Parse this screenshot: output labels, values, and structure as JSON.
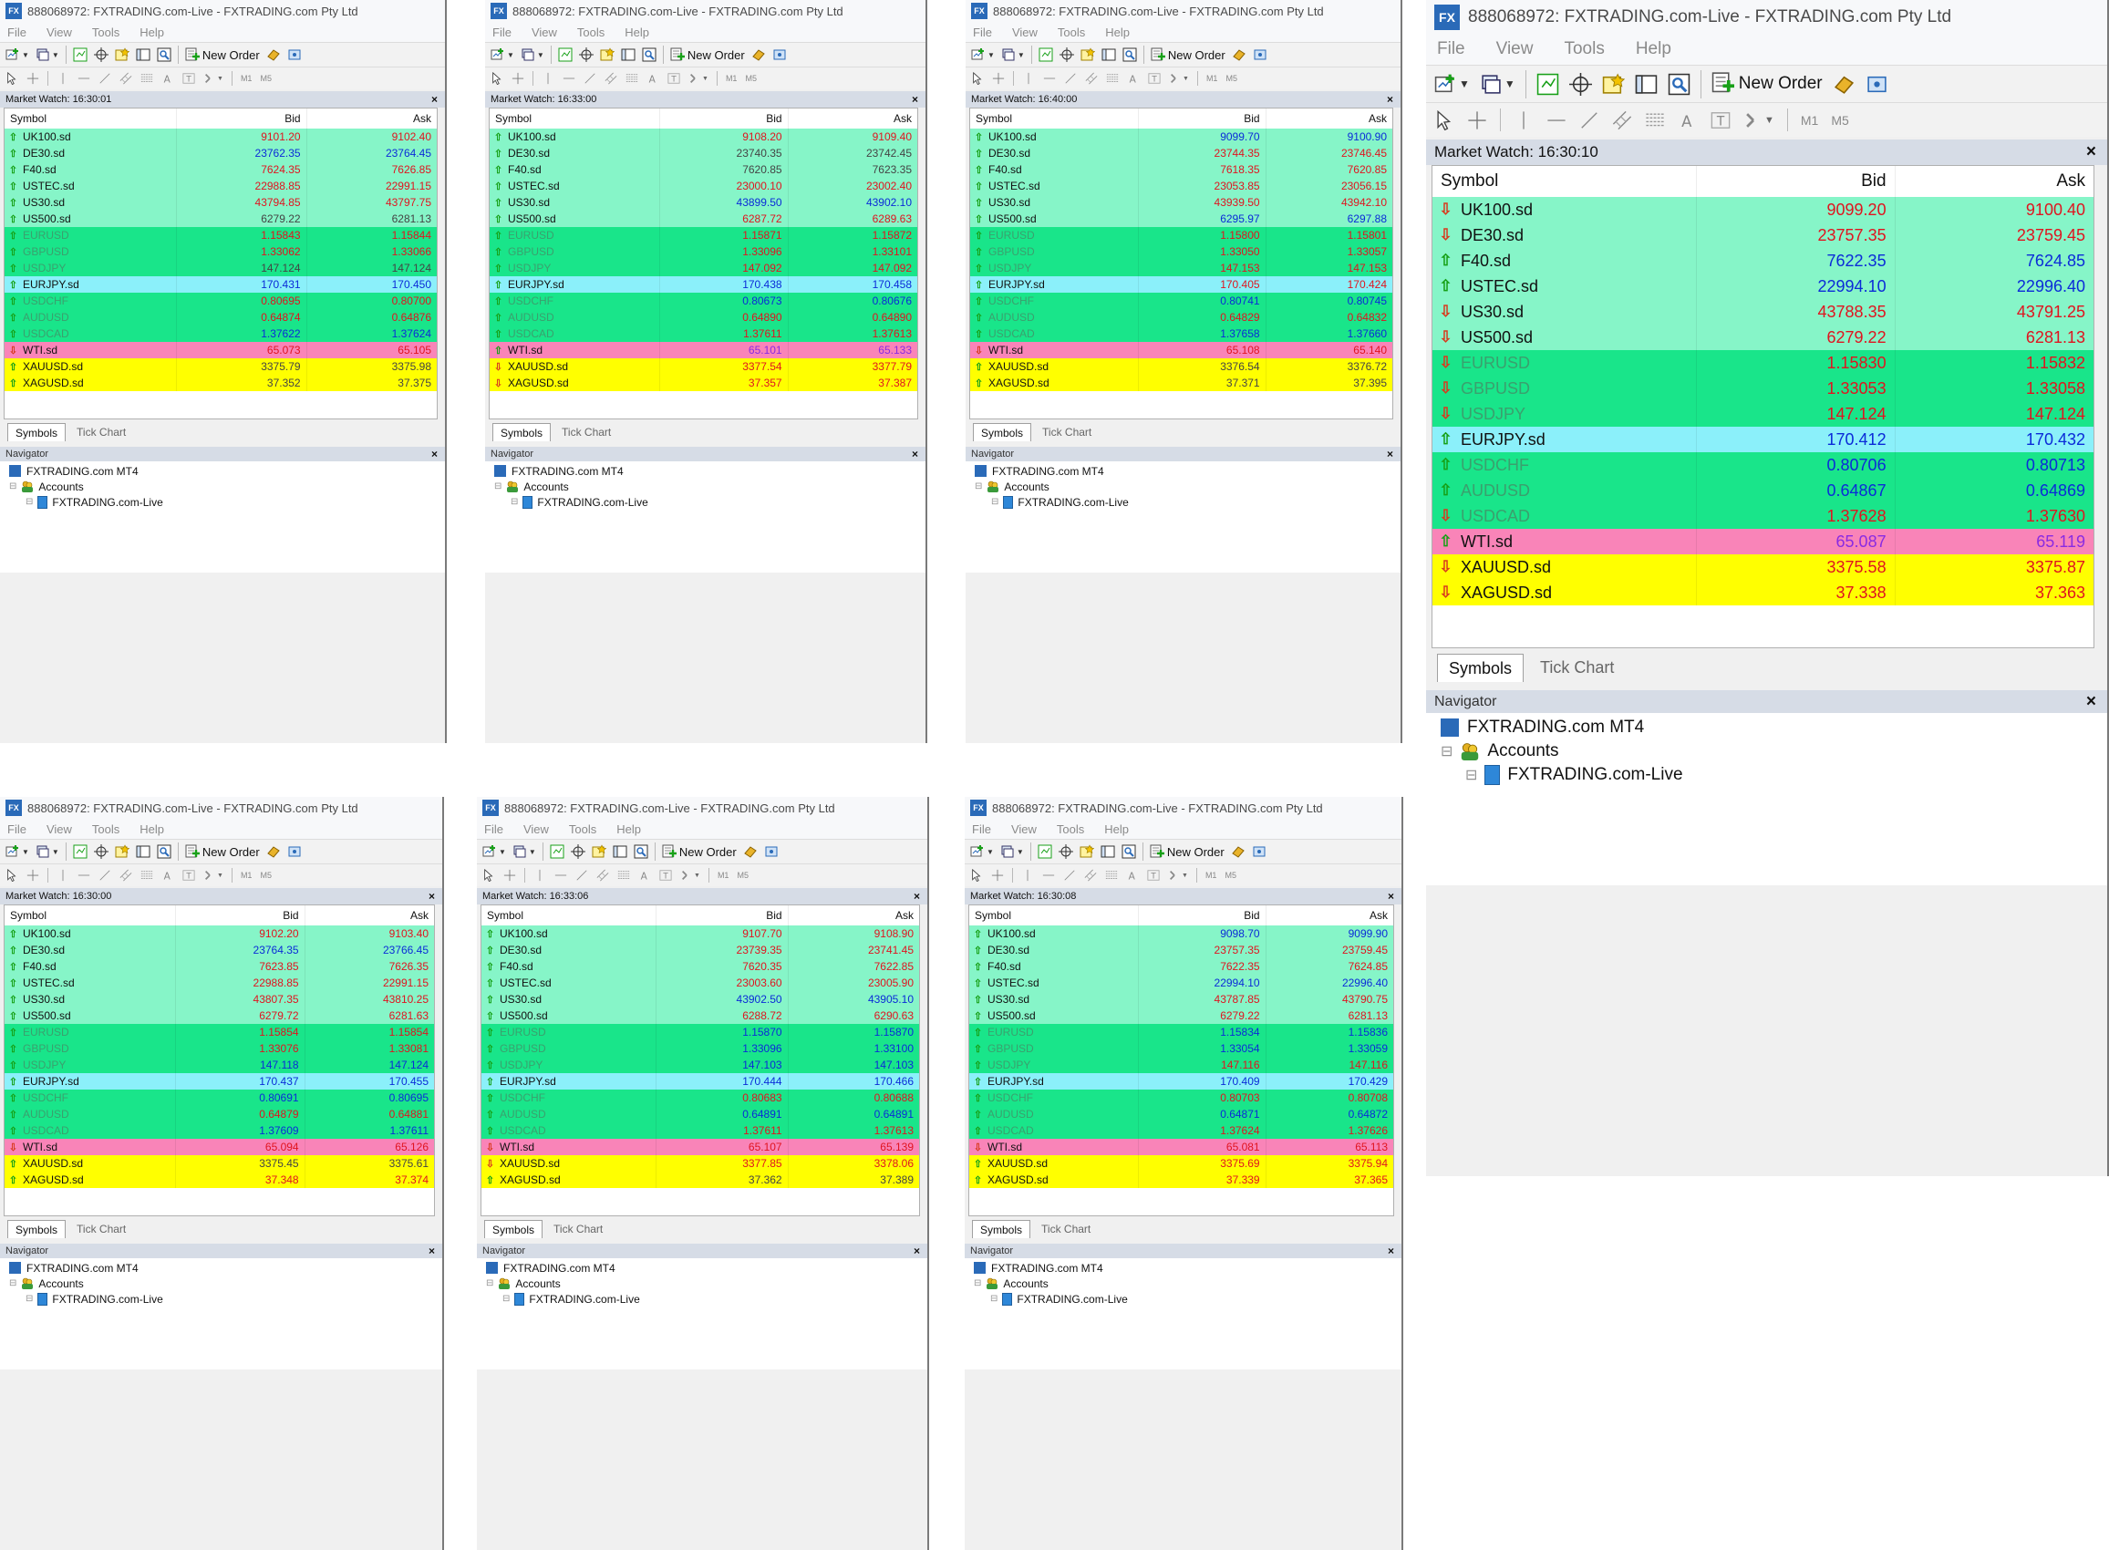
{
  "window": {
    "title": "888068972: FXTRADING.com-Live - FXTRADING.com Pty Ltd",
    "app_icon": "FX",
    "menu": [
      "File",
      "View",
      "Tools",
      "Help"
    ],
    "new_order_label": "New Order",
    "timeframe_labels": [
      "M1",
      "M5"
    ]
  },
  "market_watch": {
    "title_prefix": "Market Watch: ",
    "columns": [
      "Symbol",
      "Bid",
      "Ask"
    ],
    "tabs": [
      "Symbols",
      "Tick Chart"
    ]
  },
  "navigator": {
    "title": "Navigator",
    "root": "FXTRADING.com MT4",
    "accounts": "Accounts",
    "account": "FXTRADING.com-Live"
  },
  "colors": {
    "index_row": "#86f5c8",
    "fx_row": "#19e58a",
    "eurjpy_row": "#8bf0fa",
    "wti_row": "#f984b8",
    "metal_row": "#ffff00",
    "fx_symbol_text": "#3aa06e",
    "tick_up": "#16a016",
    "tick_down": "#d83a1e",
    "price_up": "#0b2bd8",
    "price_down": "#e0141f",
    "price_neutral": "#444444",
    "price_violet": "#8a2be2"
  },
  "snapshots": [
    {
      "time": "16:30:01",
      "rows": [
        {
          "symbol": "UK100.sd",
          "bid": "9101.20",
          "ask": "9102.40",
          "tick": "up",
          "color": "down"
        },
        {
          "symbol": "DE30.sd",
          "bid": "23762.35",
          "ask": "23764.45",
          "tick": "up",
          "color": "up"
        },
        {
          "symbol": "F40.sd",
          "bid": "7624.35",
          "ask": "7626.85",
          "tick": "up",
          "color": "down"
        },
        {
          "symbol": "USTEC.sd",
          "bid": "22988.85",
          "ask": "22991.15",
          "tick": "up",
          "color": "down"
        },
        {
          "symbol": "US30.sd",
          "bid": "43794.85",
          "ask": "43797.75",
          "tick": "up",
          "color": "down"
        },
        {
          "symbol": "US500.sd",
          "bid": "6279.22",
          "ask": "6281.13",
          "tick": "up",
          "color": "neutral"
        },
        {
          "symbol": "EURUSD",
          "bid": "1.15843",
          "ask": "1.15844",
          "tick": "up",
          "color": "down"
        },
        {
          "symbol": "GBPUSD",
          "bid": "1.33062",
          "ask": "1.33066",
          "tick": "up",
          "color": "down"
        },
        {
          "symbol": "USDJPY",
          "bid": "147.124",
          "ask": "147.124",
          "tick": "up",
          "color": "neutral"
        },
        {
          "symbol": "EURJPY.sd",
          "bid": "170.431",
          "ask": "170.450",
          "tick": "up",
          "color": "up"
        },
        {
          "symbol": "USDCHF",
          "bid": "0.80695",
          "ask": "0.80700",
          "tick": "up",
          "color": "down"
        },
        {
          "symbol": "AUDUSD",
          "bid": "0.64874",
          "ask": "0.64876",
          "tick": "up",
          "color": "down"
        },
        {
          "symbol": "USDCAD",
          "bid": "1.37622",
          "ask": "1.37624",
          "tick": "up",
          "color": "up"
        },
        {
          "symbol": "WTI.sd",
          "bid": "65.073",
          "ask": "65.105",
          "tick": "down",
          "color": "down"
        },
        {
          "symbol": "XAUUSD.sd",
          "bid": "3375.79",
          "ask": "3375.98",
          "tick": "up",
          "color": "neutral"
        },
        {
          "symbol": "XAGUSD.sd",
          "bid": "37.352",
          "ask": "37.375",
          "tick": "up",
          "color": "neutral"
        }
      ]
    },
    {
      "time": "16:33:00",
      "rows": [
        {
          "symbol": "UK100.sd",
          "bid": "9108.20",
          "ask": "9109.40",
          "tick": "up",
          "color": "down"
        },
        {
          "symbol": "DE30.sd",
          "bid": "23740.35",
          "ask": "23742.45",
          "tick": "up",
          "color": "neutral"
        },
        {
          "symbol": "F40.sd",
          "bid": "7620.85",
          "ask": "7623.35",
          "tick": "up",
          "color": "neutral"
        },
        {
          "symbol": "USTEC.sd",
          "bid": "23000.10",
          "ask": "23002.40",
          "tick": "up",
          "color": "down"
        },
        {
          "symbol": "US30.sd",
          "bid": "43899.50",
          "ask": "43902.10",
          "tick": "up",
          "color": "up"
        },
        {
          "symbol": "US500.sd",
          "bid": "6287.72",
          "ask": "6289.63",
          "tick": "up",
          "color": "down"
        },
        {
          "symbol": "EURUSD",
          "bid": "1.15871",
          "ask": "1.15872",
          "tick": "up",
          "color": "down"
        },
        {
          "symbol": "GBPUSD",
          "bid": "1.33096",
          "ask": "1.33101",
          "tick": "up",
          "color": "down"
        },
        {
          "symbol": "USDJPY",
          "bid": "147.092",
          "ask": "147.092",
          "tick": "up",
          "color": "down"
        },
        {
          "symbol": "EURJPY.sd",
          "bid": "170.438",
          "ask": "170.458",
          "tick": "up",
          "color": "up"
        },
        {
          "symbol": "USDCHF",
          "bid": "0.80673",
          "ask": "0.80676",
          "tick": "up",
          "color": "up"
        },
        {
          "symbol": "AUDUSD",
          "bid": "0.64890",
          "ask": "0.64890",
          "tick": "up",
          "color": "down"
        },
        {
          "symbol": "USDCAD",
          "bid": "1.37611",
          "ask": "1.37613",
          "tick": "up",
          "color": "down"
        },
        {
          "symbol": "WTI.sd",
          "bid": "65.101",
          "ask": "65.133",
          "tick": "up",
          "color": "violet"
        },
        {
          "symbol": "XAUUSD.sd",
          "bid": "3377.54",
          "ask": "3377.79",
          "tick": "down",
          "color": "down"
        },
        {
          "symbol": "XAGUSD.sd",
          "bid": "37.357",
          "ask": "37.387",
          "tick": "down",
          "color": "down"
        }
      ]
    },
    {
      "time": "16:40:00",
      "rows": [
        {
          "symbol": "UK100.sd",
          "bid": "9099.70",
          "ask": "9100.90",
          "tick": "up",
          "color": "up"
        },
        {
          "symbol": "DE30.sd",
          "bid": "23744.35",
          "ask": "23746.45",
          "tick": "up",
          "color": "down"
        },
        {
          "symbol": "F40.sd",
          "bid": "7618.35",
          "ask": "7620.85",
          "tick": "up",
          "color": "down"
        },
        {
          "symbol": "USTEC.sd",
          "bid": "23053.85",
          "ask": "23056.15",
          "tick": "up",
          "color": "down"
        },
        {
          "symbol": "US30.sd",
          "bid": "43939.50",
          "ask": "43942.10",
          "tick": "up",
          "color": "down"
        },
        {
          "symbol": "US500.sd",
          "bid": "6295.97",
          "ask": "6297.88",
          "tick": "up",
          "color": "up"
        },
        {
          "symbol": "EURUSD",
          "bid": "1.15800",
          "ask": "1.15801",
          "tick": "up",
          "color": "down"
        },
        {
          "symbol": "GBPUSD",
          "bid": "1.33050",
          "ask": "1.33057",
          "tick": "up",
          "color": "down"
        },
        {
          "symbol": "USDJPY",
          "bid": "147.153",
          "ask": "147.153",
          "tick": "up",
          "color": "down"
        },
        {
          "symbol": "EURJPY.sd",
          "bid": "170.405",
          "ask": "170.424",
          "tick": "up",
          "color": "down"
        },
        {
          "symbol": "USDCHF",
          "bid": "0.80741",
          "ask": "0.80745",
          "tick": "up",
          "color": "up"
        },
        {
          "symbol": "AUDUSD",
          "bid": "0.64829",
          "ask": "0.64832",
          "tick": "up",
          "color": "down"
        },
        {
          "symbol": "USDCAD",
          "bid": "1.37658",
          "ask": "1.37660",
          "tick": "up",
          "color": "up"
        },
        {
          "symbol": "WTI.sd",
          "bid": "65.108",
          "ask": "65.140",
          "tick": "down",
          "color": "down"
        },
        {
          "symbol": "XAUUSD.sd",
          "bid": "3376.54",
          "ask": "3376.72",
          "tick": "up",
          "color": "neutral"
        },
        {
          "symbol": "XAGUSD.sd",
          "bid": "37.371",
          "ask": "37.395",
          "tick": "up",
          "color": "neutral"
        }
      ]
    },
    {
      "time": "16:30:10",
      "rows": [
        {
          "symbol": "UK100.sd",
          "bid": "9099.20",
          "ask": "9100.40",
          "tick": "down",
          "color": "down"
        },
        {
          "symbol": "DE30.sd",
          "bid": "23757.35",
          "ask": "23759.45",
          "tick": "down",
          "color": "down"
        },
        {
          "symbol": "F40.sd",
          "bid": "7622.35",
          "ask": "7624.85",
          "tick": "up",
          "color": "up"
        },
        {
          "symbol": "USTEC.sd",
          "bid": "22994.10",
          "ask": "22996.40",
          "tick": "up",
          "color": "up"
        },
        {
          "symbol": "US30.sd",
          "bid": "43788.35",
          "ask": "43791.25",
          "tick": "down",
          "color": "down"
        },
        {
          "symbol": "US500.sd",
          "bid": "6279.22",
          "ask": "6281.13",
          "tick": "down",
          "color": "down"
        },
        {
          "symbol": "EURUSD",
          "bid": "1.15830",
          "ask": "1.15832",
          "tick": "down",
          "color": "down"
        },
        {
          "symbol": "GBPUSD",
          "bid": "1.33053",
          "ask": "1.33058",
          "tick": "down",
          "color": "down"
        },
        {
          "symbol": "USDJPY",
          "bid": "147.124",
          "ask": "147.124",
          "tick": "down",
          "color": "down"
        },
        {
          "symbol": "EURJPY.sd",
          "bid": "170.412",
          "ask": "170.432",
          "tick": "up",
          "color": "up"
        },
        {
          "symbol": "USDCHF",
          "bid": "0.80706",
          "ask": "0.80713",
          "tick": "up",
          "color": "up"
        },
        {
          "symbol": "AUDUSD",
          "bid": "0.64867",
          "ask": "0.64869",
          "tick": "up",
          "color": "up"
        },
        {
          "symbol": "USDCAD",
          "bid": "1.37628",
          "ask": "1.37630",
          "tick": "down",
          "color": "down"
        },
        {
          "symbol": "WTI.sd",
          "bid": "65.087",
          "ask": "65.119",
          "tick": "up",
          "color": "violet"
        },
        {
          "symbol": "XAUUSD.sd",
          "bid": "3375.58",
          "ask": "3375.87",
          "tick": "down",
          "color": "down"
        },
        {
          "symbol": "XAGUSD.sd",
          "bid": "37.338",
          "ask": "37.363",
          "tick": "down",
          "color": "down"
        }
      ]
    },
    {
      "time": "16:30:00",
      "rows": [
        {
          "symbol": "UK100.sd",
          "bid": "9102.20",
          "ask": "9103.40",
          "tick": "up",
          "color": "down"
        },
        {
          "symbol": "DE30.sd",
          "bid": "23764.35",
          "ask": "23766.45",
          "tick": "up",
          "color": "up"
        },
        {
          "symbol": "F40.sd",
          "bid": "7623.85",
          "ask": "7626.35",
          "tick": "up",
          "color": "down"
        },
        {
          "symbol": "USTEC.sd",
          "bid": "22988.85",
          "ask": "22991.15",
          "tick": "up",
          "color": "down"
        },
        {
          "symbol": "US30.sd",
          "bid": "43807.35",
          "ask": "43810.25",
          "tick": "up",
          "color": "down"
        },
        {
          "symbol": "US500.sd",
          "bid": "6279.72",
          "ask": "6281.63",
          "tick": "up",
          "color": "down"
        },
        {
          "symbol": "EURUSD",
          "bid": "1.15854",
          "ask": "1.15854",
          "tick": "up",
          "color": "down"
        },
        {
          "symbol": "GBPUSD",
          "bid": "1.33076",
          "ask": "1.33081",
          "tick": "up",
          "color": "down"
        },
        {
          "symbol": "USDJPY",
          "bid": "147.118",
          "ask": "147.124",
          "tick": "up",
          "color": "up"
        },
        {
          "symbol": "EURJPY.sd",
          "bid": "170.437",
          "ask": "170.455",
          "tick": "up",
          "color": "up"
        },
        {
          "symbol": "USDCHF",
          "bid": "0.80691",
          "ask": "0.80695",
          "tick": "up",
          "color": "up"
        },
        {
          "symbol": "AUDUSD",
          "bid": "0.64879",
          "ask": "0.64881",
          "tick": "up",
          "color": "down"
        },
        {
          "symbol": "USDCAD",
          "bid": "1.37609",
          "ask": "1.37611",
          "tick": "up",
          "color": "up"
        },
        {
          "symbol": "WTI.sd",
          "bid": "65.094",
          "ask": "65.126",
          "tick": "down",
          "color": "down"
        },
        {
          "symbol": "XAUUSD.sd",
          "bid": "3375.45",
          "ask": "3375.61",
          "tick": "up",
          "color": "neutral"
        },
        {
          "symbol": "XAGUSD.sd",
          "bid": "37.348",
          "ask": "37.374",
          "tick": "up",
          "color": "down"
        }
      ]
    },
    {
      "time": "16:33:06",
      "rows": [
        {
          "symbol": "UK100.sd",
          "bid": "9107.70",
          "ask": "9108.90",
          "tick": "up",
          "color": "down"
        },
        {
          "symbol": "DE30.sd",
          "bid": "23739.35",
          "ask": "23741.45",
          "tick": "up",
          "color": "down"
        },
        {
          "symbol": "F40.sd",
          "bid": "7620.35",
          "ask": "7622.85",
          "tick": "up",
          "color": "down"
        },
        {
          "symbol": "USTEC.sd",
          "bid": "23003.60",
          "ask": "23005.90",
          "tick": "up",
          "color": "down"
        },
        {
          "symbol": "US30.sd",
          "bid": "43902.50",
          "ask": "43905.10",
          "tick": "up",
          "color": "up"
        },
        {
          "symbol": "US500.sd",
          "bid": "6288.72",
          "ask": "6290.63",
          "tick": "up",
          "color": "down"
        },
        {
          "symbol": "EURUSD",
          "bid": "1.15870",
          "ask": "1.15870",
          "tick": "up",
          "color": "up"
        },
        {
          "symbol": "GBPUSD",
          "bid": "1.33096",
          "ask": "1.33100",
          "tick": "up",
          "color": "up"
        },
        {
          "symbol": "USDJPY",
          "bid": "147.103",
          "ask": "147.103",
          "tick": "up",
          "color": "up"
        },
        {
          "symbol": "EURJPY.sd",
          "bid": "170.444",
          "ask": "170.466",
          "tick": "up",
          "color": "up"
        },
        {
          "symbol": "USDCHF",
          "bid": "0.80683",
          "ask": "0.80688",
          "tick": "up",
          "color": "down"
        },
        {
          "symbol": "AUDUSD",
          "bid": "0.64891",
          "ask": "0.64891",
          "tick": "up",
          "color": "up"
        },
        {
          "symbol": "USDCAD",
          "bid": "1.37611",
          "ask": "1.37613",
          "tick": "up",
          "color": "down"
        },
        {
          "symbol": "WTI.sd",
          "bid": "65.107",
          "ask": "65.139",
          "tick": "down",
          "color": "down"
        },
        {
          "symbol": "XAUUSD.sd",
          "bid": "3377.85",
          "ask": "3378.06",
          "tick": "down",
          "color": "down"
        },
        {
          "symbol": "XAGUSD.sd",
          "bid": "37.362",
          "ask": "37.389",
          "tick": "up",
          "color": "neutral"
        }
      ]
    },
    {
      "time": "16:30:08",
      "rows": [
        {
          "symbol": "UK100.sd",
          "bid": "9098.70",
          "ask": "9099.90",
          "tick": "up",
          "color": "up"
        },
        {
          "symbol": "DE30.sd",
          "bid": "23757.35",
          "ask": "23759.45",
          "tick": "up",
          "color": "down"
        },
        {
          "symbol": "F40.sd",
          "bid": "7622.35",
          "ask": "7624.85",
          "tick": "up",
          "color": "down"
        },
        {
          "symbol": "USTEC.sd",
          "bid": "22994.10",
          "ask": "22996.40",
          "tick": "up",
          "color": "up"
        },
        {
          "symbol": "US30.sd",
          "bid": "43787.85",
          "ask": "43790.75",
          "tick": "up",
          "color": "down"
        },
        {
          "symbol": "US500.sd",
          "bid": "6279.22",
          "ask": "6281.13",
          "tick": "up",
          "color": "down"
        },
        {
          "symbol": "EURUSD",
          "bid": "1.15834",
          "ask": "1.15836",
          "tick": "up",
          "color": "up"
        },
        {
          "symbol": "GBPUSD",
          "bid": "1.33054",
          "ask": "1.33059",
          "tick": "up",
          "color": "up"
        },
        {
          "symbol": "USDJPY",
          "bid": "147.116",
          "ask": "147.116",
          "tick": "up",
          "color": "down"
        },
        {
          "symbol": "EURJPY.sd",
          "bid": "170.409",
          "ask": "170.429",
          "tick": "up",
          "color": "up"
        },
        {
          "symbol": "USDCHF",
          "bid": "0.80703",
          "ask": "0.80708",
          "tick": "up",
          "color": "down"
        },
        {
          "symbol": "AUDUSD",
          "bid": "0.64871",
          "ask": "0.64872",
          "tick": "up",
          "color": "up"
        },
        {
          "symbol": "USDCAD",
          "bid": "1.37624",
          "ask": "1.37626",
          "tick": "up",
          "color": "down"
        },
        {
          "symbol": "WTI.sd",
          "bid": "65.081",
          "ask": "65.113",
          "tick": "down",
          "color": "down"
        },
        {
          "symbol": "XAUUSD.sd",
          "bid": "3375.69",
          "ask": "3375.94",
          "tick": "up",
          "color": "down"
        },
        {
          "symbol": "XAGUSD.sd",
          "bid": "37.339",
          "ask": "37.365",
          "tick": "up",
          "color": "down"
        }
      ]
    }
  ]
}
